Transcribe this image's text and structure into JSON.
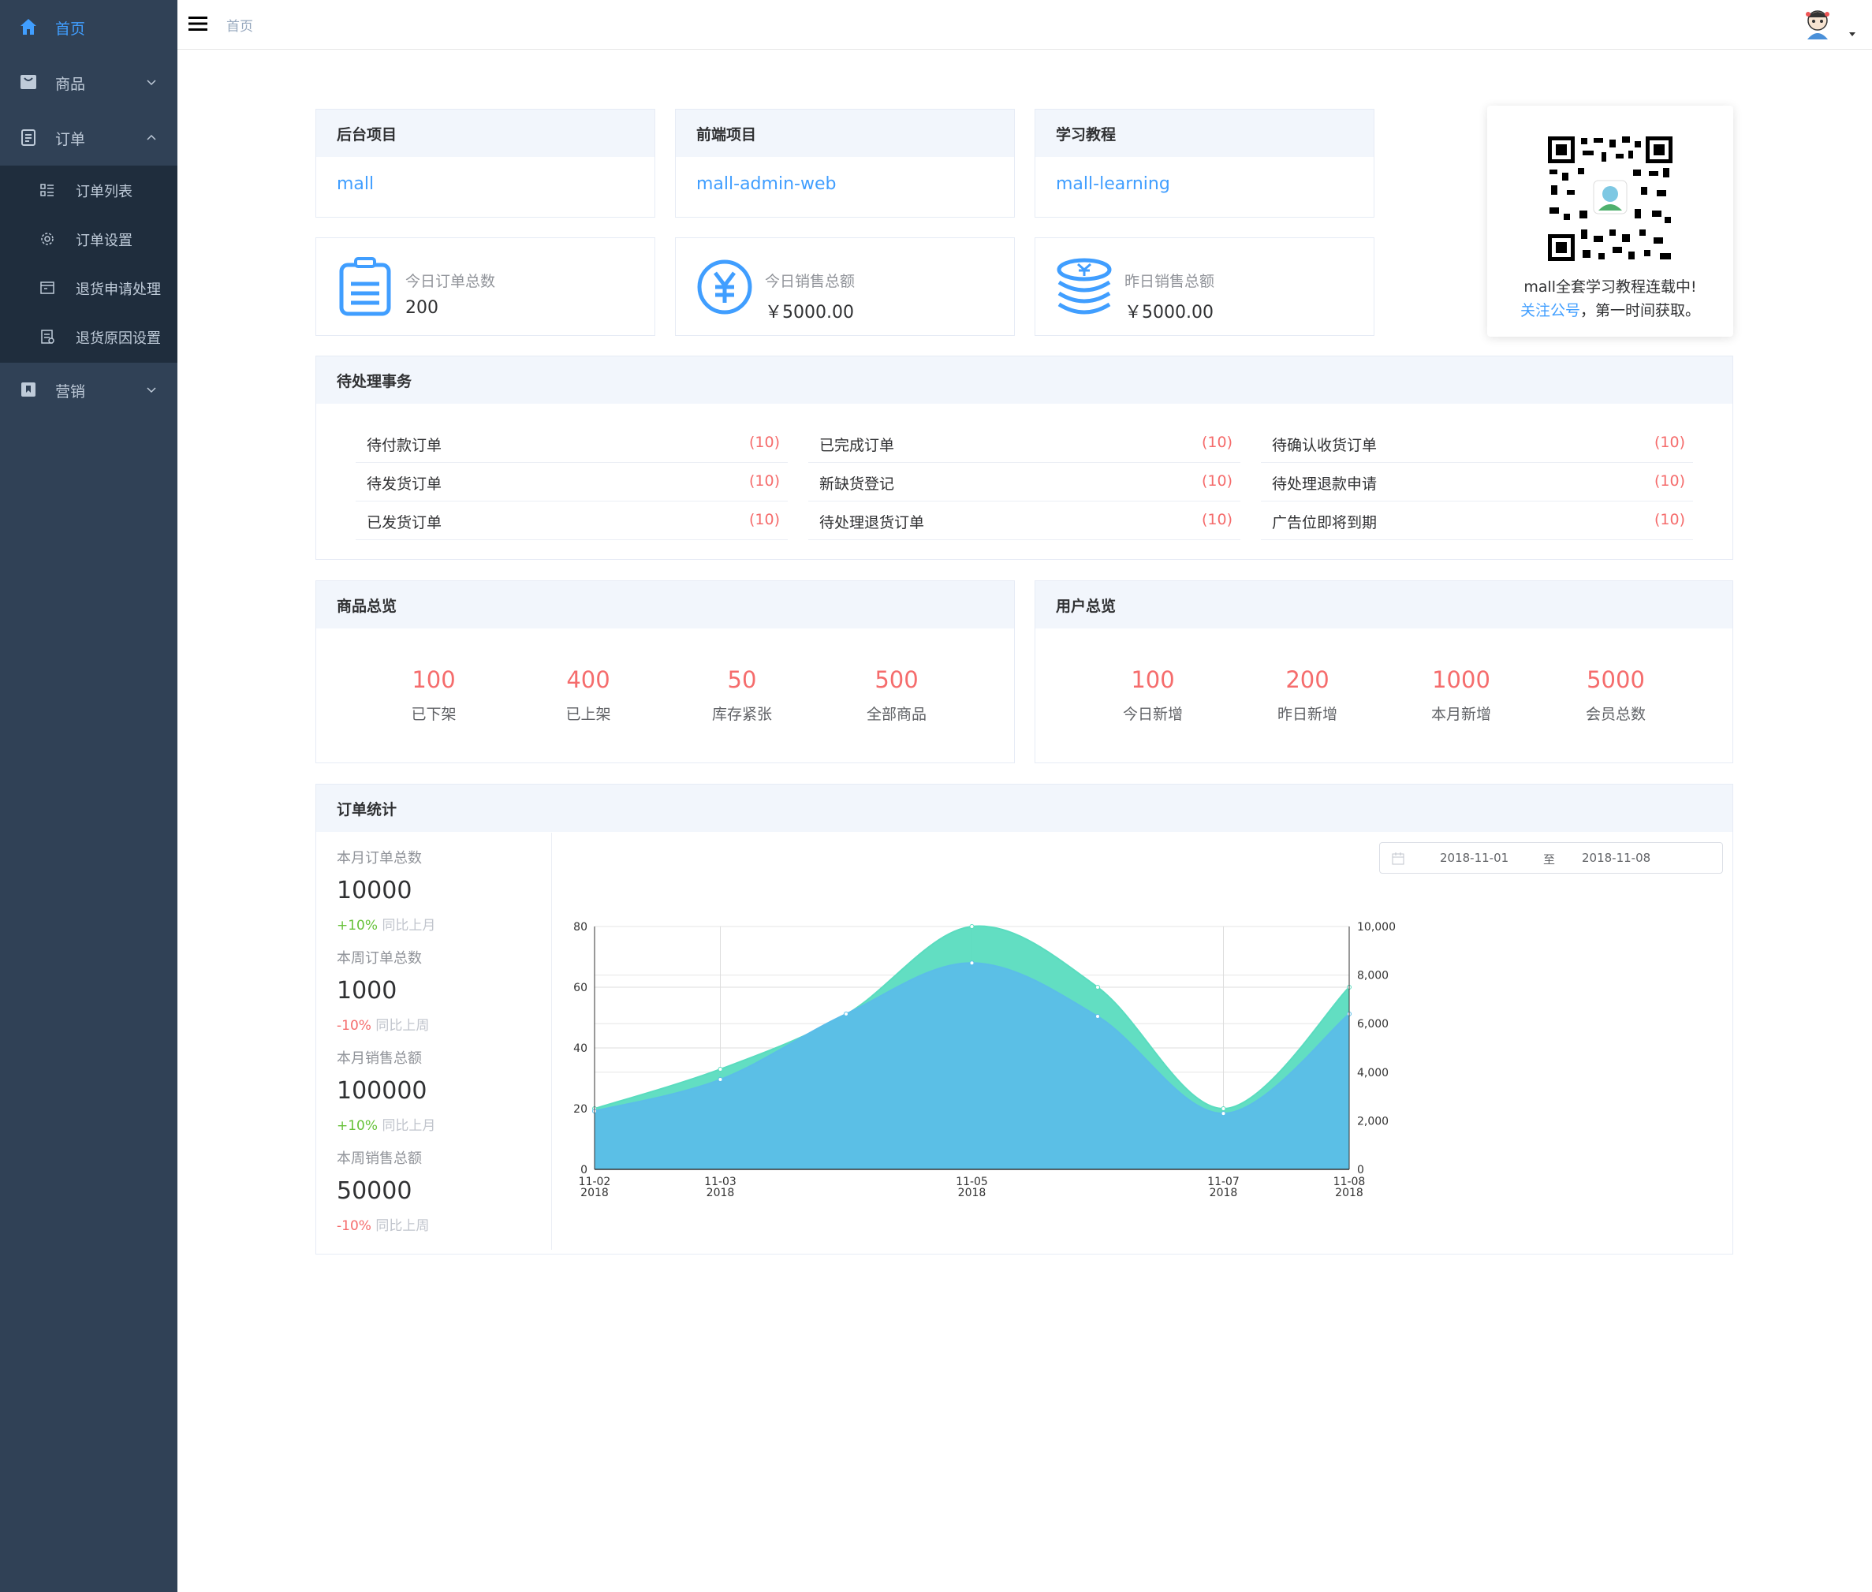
{
  "sidebar": {
    "items": [
      {
        "label": "首页",
        "icon": "home-icon",
        "active": true
      },
      {
        "label": "商品",
        "icon": "shopping-bag-icon"
      },
      {
        "label": "订单",
        "icon": "clipboard-icon",
        "expanded": true
      },
      {
        "label": "营销",
        "icon": "bookmark-icon"
      }
    ],
    "order_submenu": [
      {
        "label": "订单列表",
        "icon": "list-icon"
      },
      {
        "label": "订单设置",
        "icon": "gear-icon"
      },
      {
        "label": "退货申请处理",
        "icon": "return-box-icon"
      },
      {
        "label": "退货原因设置",
        "icon": "document-icon"
      }
    ]
  },
  "navbar": {
    "breadcrumb": "首页"
  },
  "projects": [
    {
      "title": "后台项目",
      "link": "mall"
    },
    {
      "title": "前端项目",
      "link": "mall-admin-web"
    },
    {
      "title": "学习教程",
      "link": "mall-learning"
    }
  ],
  "stats": [
    {
      "label": "今日订单总数",
      "value": "200",
      "icon": "order-clipboard-icon"
    },
    {
      "label": "今日销售总额",
      "value": "￥5000.00",
      "icon": "yuan-circle-icon"
    },
    {
      "label": "昨日销售总额",
      "value": "￥5000.00",
      "icon": "coin-stack-icon"
    }
  ],
  "qr": {
    "line1": "mall全套学习教程连载中!",
    "link": "关注公号",
    "line2_rest": "，第一时间获取。"
  },
  "todo": {
    "title": "待处理事务",
    "columns": [
      [
        {
          "label": "待付款订单",
          "count": "(10)"
        },
        {
          "label": "待发货订单",
          "count": "(10)"
        },
        {
          "label": "已发货订单",
          "count": "(10)"
        }
      ],
      [
        {
          "label": "已完成订单",
          "count": "(10)"
        },
        {
          "label": "新缺货登记",
          "count": "(10)"
        },
        {
          "label": "待处理退货订单",
          "count": "(10)"
        }
      ],
      [
        {
          "label": "待确认收货订单",
          "count": "(10)"
        },
        {
          "label": "待处理退款申请",
          "count": "(10)"
        },
        {
          "label": "广告位即将到期",
          "count": "(10)"
        }
      ]
    ]
  },
  "product_overview": {
    "title": "商品总览",
    "items": [
      {
        "num": "100",
        "label": "已下架"
      },
      {
        "num": "400",
        "label": "已上架"
      },
      {
        "num": "50",
        "label": "库存紧张"
      },
      {
        "num": "500",
        "label": "全部商品"
      }
    ]
  },
  "user_overview": {
    "title": "用户总览",
    "items": [
      {
        "num": "100",
        "label": "今日新增"
      },
      {
        "num": "200",
        "label": "昨日新增"
      },
      {
        "num": "1000",
        "label": "本月新增"
      },
      {
        "num": "5000",
        "label": "会员总数"
      }
    ]
  },
  "order_stats": {
    "title": "订单统计",
    "blocks": [
      {
        "title": "本月订单总数",
        "value": "10000",
        "trend": "+10%",
        "trend_dir": "up",
        "compare": "同比上月"
      },
      {
        "title": "本周订单总数",
        "value": "1000",
        "trend": "-10%",
        "trend_dir": "down",
        "compare": "同比上周"
      },
      {
        "title": "本月销售总额",
        "value": "100000",
        "trend": "+10%",
        "trend_dir": "up",
        "compare": "同比上月"
      },
      {
        "title": "本周销售总额",
        "value": "50000",
        "trend": "-10%",
        "trend_dir": "down",
        "compare": "同比上周"
      }
    ],
    "date_start": "2018-11-01",
    "date_sep": "至",
    "date_end": "2018-11-08"
  },
  "chart_data": {
    "type": "area",
    "x": [
      "2018-11-02",
      "2018-11-03",
      "2018-11-04",
      "2018-11-05",
      "2018-11-06",
      "2018-11-07",
      "2018-11-08"
    ],
    "x_ticks": [
      {
        "date": "2018-11-02",
        "top": "11-02",
        "bottom": "2018"
      },
      {
        "date": "2018-11-03",
        "top": "11-03",
        "bottom": "2018"
      },
      {
        "date": "2018-11-05",
        "top": "11-05",
        "bottom": "2018"
      },
      {
        "date": "2018-11-07",
        "top": "11-07",
        "bottom": "2018"
      },
      {
        "date": "2018-11-08",
        "top": "11-08",
        "bottom": "2018"
      }
    ],
    "series": [
      {
        "axis": "left",
        "color": "#5adcbf",
        "values": [
          20,
          33,
          51,
          80,
          60,
          20,
          60
        ]
      },
      {
        "axis": "right",
        "color": "#5bbde8",
        "values": [
          2400,
          3700,
          6400,
          8500,
          6300,
          2300,
          6400
        ]
      }
    ],
    "ylim_left": [
      0,
      80
    ],
    "ylim_right": [
      0,
      10000
    ],
    "yticks_left": [
      "0",
      "20",
      "40",
      "60",
      "80"
    ],
    "yticks_right": [
      "0",
      "2,000",
      "4,000",
      "6,000",
      "8,000",
      "10,000"
    ],
    "grid": true
  }
}
